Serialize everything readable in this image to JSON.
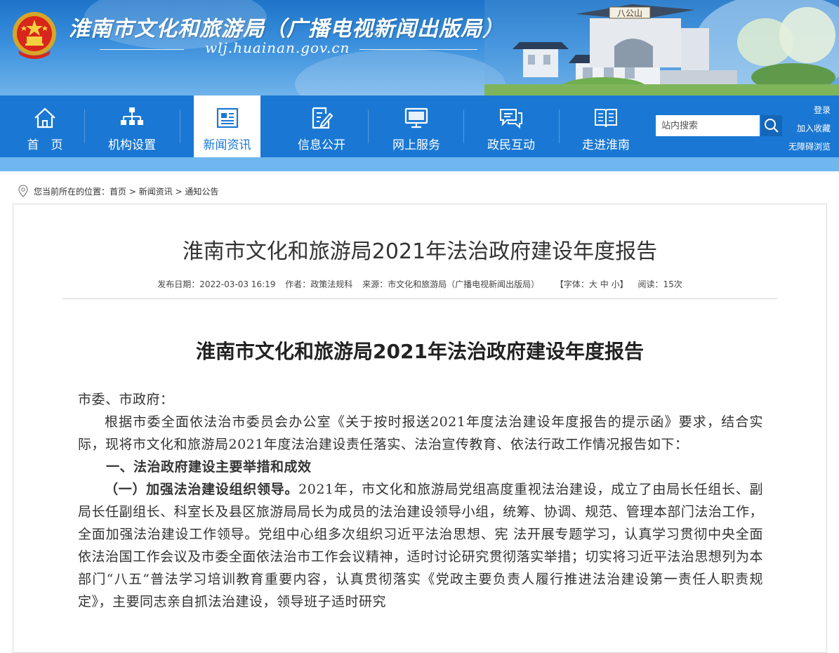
{
  "header": {
    "title": "淮南市文化和旅游局（广播电视新闻出版局）",
    "url": "wlj.huainan.gov.cn",
    "gate_sign": "八公山"
  },
  "nav": {
    "items": [
      {
        "label": "首　页",
        "icon": "home-icon"
      },
      {
        "label": "机构设置",
        "icon": "org-chart-icon"
      },
      {
        "label": "新闻资讯",
        "icon": "news-icon",
        "active": true
      },
      {
        "label": "信息公开",
        "icon": "edit-doc-icon"
      },
      {
        "label": "网上服务",
        "icon": "monitor-icon"
      },
      {
        "label": "政民互动",
        "icon": "chat-icon"
      },
      {
        "label": "走进淮南",
        "icon": "book-icon"
      }
    ],
    "search_placeholder": "站内搜索",
    "links": {
      "login": "登录",
      "favorite": "加入收藏",
      "accessible": "无障碍浏览"
    }
  },
  "breadcrumb": {
    "prefix": "您当前所在的位置：",
    "items": [
      "首页",
      "新闻资讯",
      "通知公告"
    ],
    "sep": " > "
  },
  "article": {
    "title": "淮南市文化和旅游局2021年法治政府建设年度报告",
    "meta": {
      "date": "发布日期：2022-03-03 16:19",
      "author": "作者：政策法规科",
      "source": "来源：市文化和旅游局（广播电视新闻出版局）",
      "font_prefix": "【字体：",
      "font_large": "大",
      "font_medium": "中",
      "font_small": "小",
      "font_suffix": "】",
      "views": "阅读：15次"
    },
    "content_title": "淮南市文化和旅游局2021年法治政府建设年度报告",
    "salutation": "市委、市政府：",
    "para1": "根据市委全面依法治市委员会办公室《关于按时报送2021年度法治建设年度报告的提示函》要求，结合实际，现将市文化和旅游局2021年度法治建设责任落实、法治宣传教育、依法行政工作情况报告如下：",
    "section1": "一、法治政府建设主要举措和成效",
    "sub1_title": "（一）加强法治建设组织领导。",
    "sub1_text": "2021年，市文化和旅游局党组高度重视法治建设，成立了由局长任组长、副局长任副组长、科室长及县区旅游局局长为成员的法治建设领导小组，统筹、协调、规范、管理本部门法治工作，全面加强法治建设工作领导。党组中心组多次组织习近平法治思想、宪 法开展专题学习，认真学习贯彻中央全面依法治国工作会议及市委全面依法治市工作会议精神，适时讨论研究贯彻落实举措；切实将习近平法治思想列为本部门“八五”普法学习培训教育重要内容，认真贯彻落实《党政主要负责人履行推进法治建设第一责任人职责规定》，主要同志亲自抓法治建设，领导班子适时研究"
  },
  "colors": {
    "nav_blue": "#1a78d4",
    "nav_strip": "#6fb7ef",
    "active_text": "#1a78d4"
  }
}
